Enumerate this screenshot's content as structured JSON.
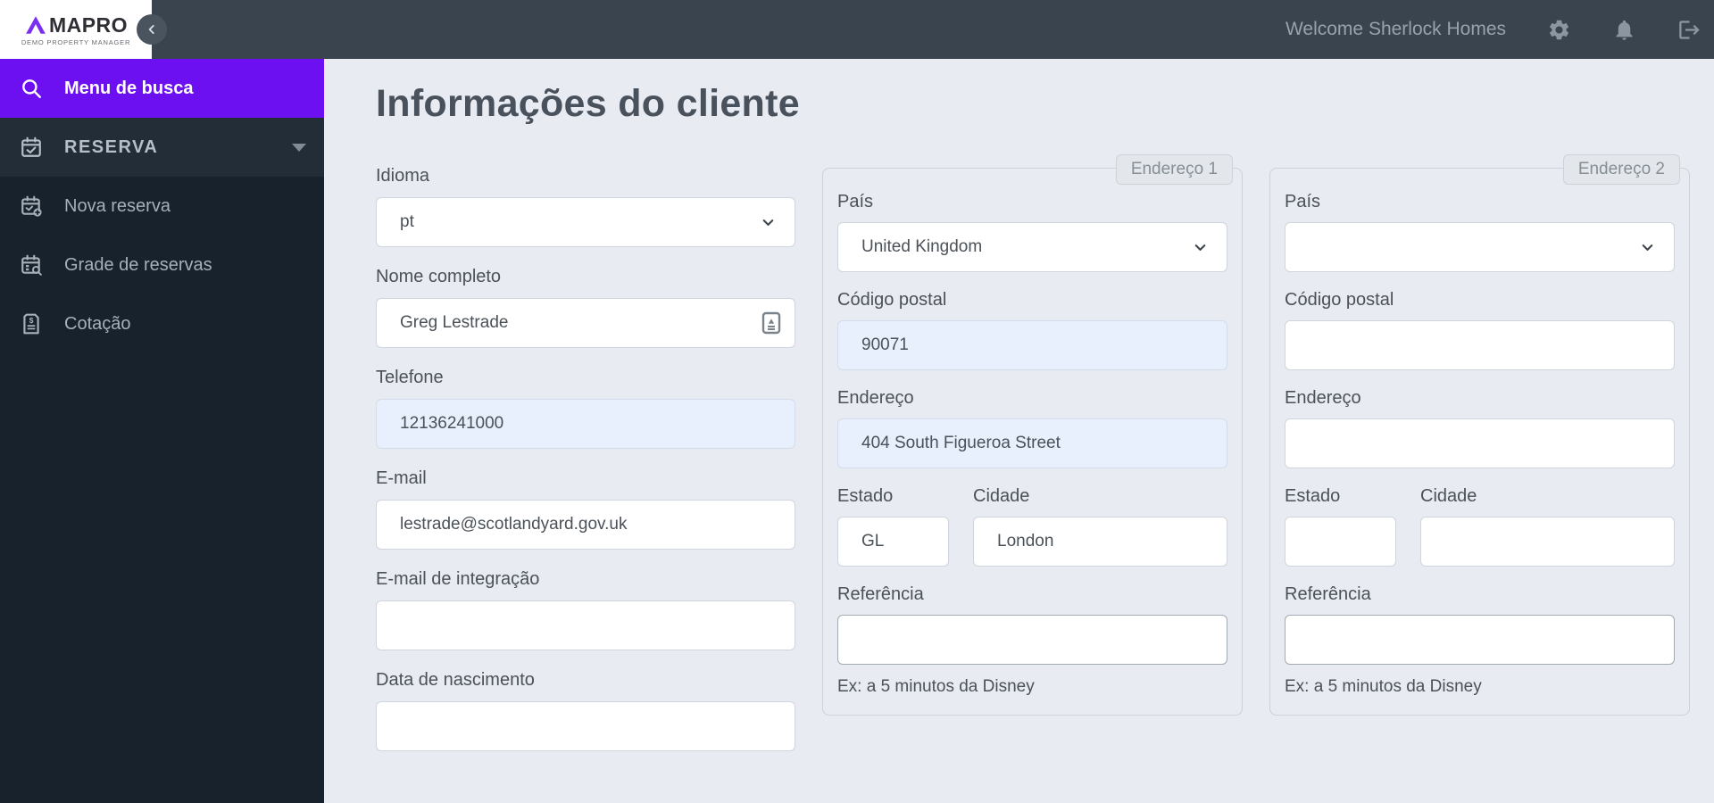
{
  "brand": {
    "name": "MAPRO",
    "tagline": "DEMO PROPERTY MANAGER"
  },
  "topbar": {
    "welcome": "Welcome Sherlock Homes"
  },
  "sidebar": {
    "search_item": "Menu de busca",
    "section_item": "RESERVA",
    "items": [
      {
        "label": "Nova reserva"
      },
      {
        "label": "Grade de reservas"
      },
      {
        "label": "Cotação"
      }
    ]
  },
  "page": {
    "title": "Informações do cliente"
  },
  "client": {
    "idioma": {
      "label": "Idioma",
      "value": "pt"
    },
    "nome": {
      "label": "Nome completo",
      "value": "Greg Lestrade"
    },
    "telefone": {
      "label": "Telefone",
      "value": "12136241000"
    },
    "email": {
      "label": "E-mail",
      "value": "lestrade@scotlandyard.gov.uk"
    },
    "email_integracao": {
      "label": "E-mail de integração",
      "value": ""
    },
    "nascimento": {
      "label": "Data de nascimento",
      "value": ""
    }
  },
  "address_labels": {
    "pais": "País",
    "codigo_postal": "Código postal",
    "endereco": "Endereço",
    "estado": "Estado",
    "cidade": "Cidade",
    "referencia": "Referência",
    "hint": "Ex: a 5 minutos da Disney"
  },
  "address1": {
    "badge": "Endereço 1",
    "pais": "United Kingdom",
    "codigo_postal": "90071",
    "endereco": "404 South Figueroa Street",
    "estado": "GL",
    "cidade": "London",
    "referencia": ""
  },
  "address2": {
    "badge": "Endereço 2",
    "pais": "",
    "codigo_postal": "",
    "endereco": "",
    "estado": "",
    "cidade": "",
    "referencia": ""
  },
  "colors": {
    "accent_purple": "#6c10f2",
    "topbar_bg": "#3a444e",
    "sidebar_bg": "#18222c",
    "autofill_bg": "#e8f0fe",
    "main_bg": "#e8ebf1"
  }
}
